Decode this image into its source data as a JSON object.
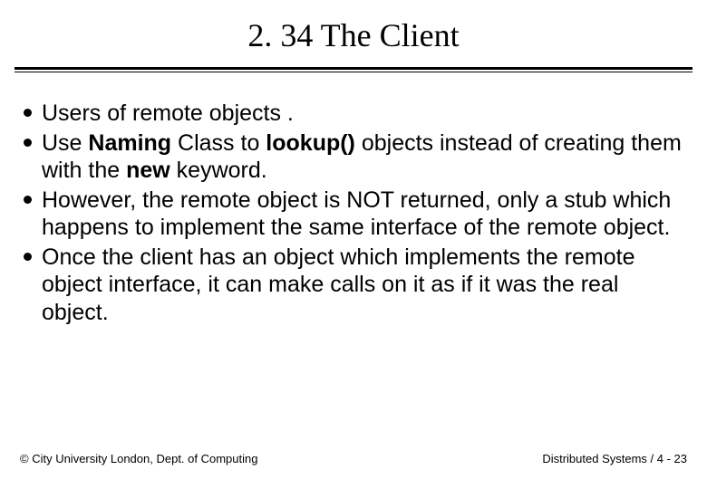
{
  "title": "2. 34 The Client",
  "bullets": [
    {
      "segments": [
        {
          "text": "Users of remote objects .",
          "bold": false
        }
      ]
    },
    {
      "segments": [
        {
          "text": "Use ",
          "bold": false
        },
        {
          "text": "Naming",
          "bold": true
        },
        {
          "text": " Class  to ",
          "bold": false
        },
        {
          "text": "lookup()",
          "bold": true
        },
        {
          "text": " objects instead of creating them with the ",
          "bold": false
        },
        {
          "text": "new",
          "bold": true
        },
        {
          "text": " keyword.",
          "bold": false
        }
      ]
    },
    {
      "segments": [
        {
          "text": "However, the remote object is NOT returned, only a stub which happens to implement the same interface of the remote object.",
          "bold": false
        }
      ]
    },
    {
      "segments": [
        {
          "text": "Once the client has an object which implements the remote object interface, it can make calls on it as if it was the real object.",
          "bold": false
        }
      ]
    }
  ],
  "footer": {
    "left": "© City University London, Dept. of Computing",
    "right": "Distributed Systems / 4 - 23"
  }
}
